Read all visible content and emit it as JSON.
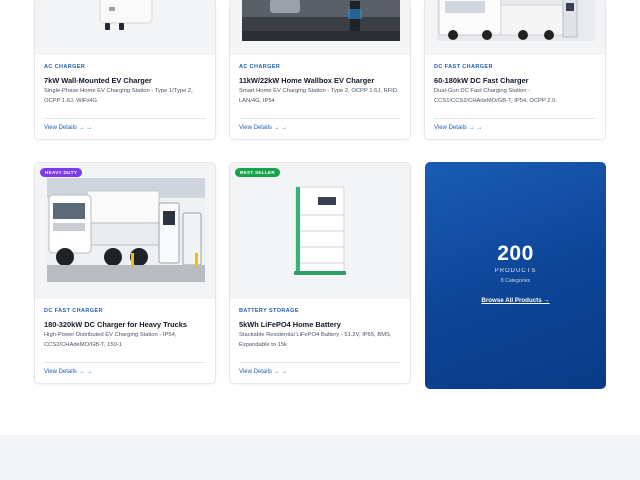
{
  "cards": [
    {
      "category": "AC CHARGER",
      "title": "7kW Wall-Mounted EV Charger",
      "description": "Single-Phase Home EV Charging Station - Type 1/Type 2, OCPP 1.6J, WiFi/4G",
      "link": "View Details → →"
    },
    {
      "category": "AC CHARGER",
      "title": "11kW/22kW Home Wallbox EV Charger",
      "description": "Smart Home EV Charging Station - Type 2, OCPP 1.6J, RFID, LAN/4G, IP54",
      "link": "View Details → →"
    },
    {
      "category": "DC FAST CHARGER",
      "title": "60-180kW DC Fast Charger",
      "description": "Dual-Gun DC Fast Charging Station - CCS1/CCS2/CHAdeMO/GB-T, IP54, OCPP 2.0.",
      "link": "View Details → →"
    },
    {
      "badge": "HEAVY DUTY",
      "category": "DC FAST CHARGER",
      "title": "180-320kW DC Charger for Heavy Trucks",
      "description": "High-Power Distributed EV Charging Station - IP54, CCS2/CHAdeMO/GB-T, 150-1",
      "link": "View Details → →"
    },
    {
      "badge": "BEST SELLER",
      "category": "BATTERY STORAGE",
      "title": "5kWh LiFePO4 Home Battery",
      "description": "Stackable Residential LiFePO4 Battery - 51.2V, IP65, BMS, Expandable to 15k",
      "link": "View Details → →"
    }
  ],
  "promo": {
    "count": "200",
    "label": "PRODUCTS",
    "sub": "8 Categories",
    "browse": "Browse All Products →"
  },
  "colors": {
    "accent": "#1f5fae",
    "promo_bg": "#0d4496",
    "badge_heavy": "#7c3aed",
    "badge_best": "#16a34a"
  }
}
